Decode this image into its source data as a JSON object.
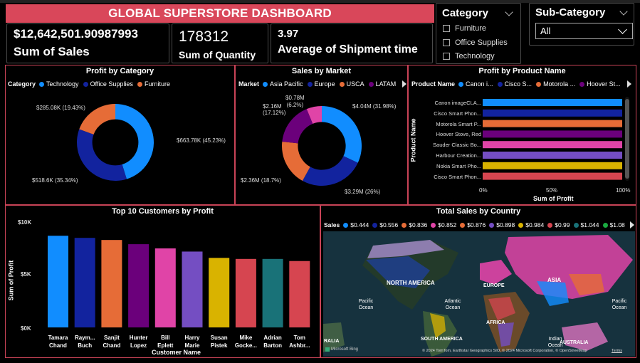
{
  "header": {
    "title": "GLOBAL SUPERSTORE DASHBOARD"
  },
  "kpis": [
    {
      "value": "$12,642,501.90987993",
      "label": "Sum of Sales"
    },
    {
      "value": "178312",
      "label": "Sum of Quantity"
    },
    {
      "value": "3.97",
      "label": "Average of Shipment time"
    }
  ],
  "category_slicer": {
    "title": "Category",
    "options": [
      "Furniture",
      "Office Supplies",
      "Technology"
    ]
  },
  "subcategory_slicer": {
    "title": "Sub-Category",
    "selected": "All"
  },
  "colors": {
    "accent": "#d9475a",
    "border": "#c94357",
    "technology": "#118dff",
    "office_supplies": "#12239e",
    "furniture": "#e66c37",
    "asia_pacific": "#118dff",
    "europe": "#12239e",
    "usca": "#e66c37",
    "latam": "#6b007b",
    "extra": "#e044a7"
  },
  "profit_by_category": {
    "title": "Profit by Category",
    "legend_title": "Category",
    "legend": [
      "Technology",
      "Office Supplies",
      "Furniture"
    ],
    "chart_data": {
      "type": "pie",
      "categories": [
        "Technology",
        "Office Supplies",
        "Furniture"
      ],
      "values": [
        663.78,
        518.6,
        285.08
      ],
      "labels": [
        "$663.78K (45.23%)",
        "$518.6K (35.34%)",
        "$285.08K (19.43%)"
      ]
    }
  },
  "sales_by_market": {
    "title": "Sales by Market",
    "legend_title": "Market",
    "legend": [
      "Asia Pacific",
      "Europe",
      "USCA",
      "LATAM"
    ],
    "chart_data": {
      "type": "pie",
      "categories": [
        "Asia Pacific",
        "Europe",
        "USCA",
        "LATAM",
        "Other"
      ],
      "values": [
        4.04,
        3.29,
        2.36,
        2.16,
        0.78
      ],
      "labels": [
        "$4.04M (31.98%)",
        "$3.29M (26%)",
        "$2.36M (18.7%)",
        "$2.16M (17.12%)",
        "$0.78M (6.2%)"
      ]
    }
  },
  "profit_by_product": {
    "title": "Profit by Product Name",
    "legend_title": "Product Name",
    "legend": [
      "Canon i...",
      "Cisco S...",
      "Motorola ...",
      "Hoover St..."
    ],
    "ylabel": "Product Name",
    "xlabel": "Sum of Profit",
    "x_ticks": [
      "0%",
      "50%",
      "100%"
    ],
    "chart_data": {
      "type": "bar",
      "orientation": "horizontal",
      "categories": [
        "Canon imageCLA...",
        "Cisco Smart Phon...",
        "Motorola Smart P...",
        "Hoover Stove, Red",
        "Sauder Classic Bo...",
        "Harbour Creation...",
        "Nokia Smart Pho...",
        "Cisco Smart Phon..."
      ],
      "values": [
        100,
        100,
        100,
        100,
        100,
        100,
        100,
        100
      ],
      "xlim": [
        0,
        100
      ],
      "colors": [
        "#118dff",
        "#12239e",
        "#e66c37",
        "#6b007b",
        "#e044a7",
        "#744ec2",
        "#d9b300",
        "#d64550"
      ]
    }
  },
  "top_customers": {
    "title": "Top 10 Customers by Profit",
    "ylabel": "Sum of Profit",
    "xlabel": "Customer Name",
    "y_ticks": [
      "$10K",
      "$5K",
      "$0K"
    ],
    "chart_data": {
      "type": "bar",
      "categories": [
        "Tamara Chand",
        "Raymond Buch",
        "Sanjit Chand",
        "Hunter Lopez",
        "Bill Eplett",
        "Harry Marie",
        "Susan Pistek",
        "Mike Gockenbach",
        "Adrian Barton",
        "Tom Ashbrook"
      ],
      "display_names": [
        [
          "Tamara",
          "Chand"
        ],
        [
          "Raym...",
          "Buch"
        ],
        [
          "Sanjit",
          "Chand"
        ],
        [
          "Hunter",
          "Lopez"
        ],
        [
          "Bill",
          "Eplett"
        ],
        [
          "Harry",
          "Marie"
        ],
        [
          "Susan",
          "Pistek"
        ],
        [
          "Mike",
          "Gocke..."
        ],
        [
          "Adrian",
          "Barton"
        ],
        [
          "Tom",
          "Ashbr..."
        ]
      ],
      "values": [
        8.7,
        8.5,
        8.3,
        7.9,
        7.5,
        7.2,
        6.6,
        6.5,
        6.5,
        6.3
      ],
      "ylim": [
        0,
        10
      ],
      "colors": [
        "#118dff",
        "#12239e",
        "#e66c37",
        "#6b007b",
        "#e044a7",
        "#744ec2",
        "#d9b300",
        "#d64550",
        "#197278",
        "#d64550"
      ]
    }
  },
  "sales_by_country": {
    "title": "Total Sales by Country",
    "legend_title": "Sales",
    "legend": [
      "$0.444",
      "$0.556",
      "$0.836",
      "$0.852",
      "$0.876",
      "$0.898",
      "$0.984",
      "$0.99",
      "$1.044",
      "$1.08"
    ],
    "legend_colors": [
      "#118dff",
      "#12239e",
      "#e66c37",
      "#e044a7",
      "#e66c37",
      "#744ec2",
      "#d9b300",
      "#d64550",
      "#197278",
      "#1aab40"
    ],
    "map_labels": [
      "NORTH AMERICA",
      "EUROPE",
      "ASIA",
      "AFRICA",
      "SOUTH AMERICA",
      "AUSTRALIA",
      "Pacific Ocean",
      "Atlantic Ocean",
      "Indian Ocean",
      "Pacific Ocean",
      "RALIA"
    ],
    "attribution": "© 2024 TomTom, Earthstar Geographics SIO, © 2024 Microsoft Corporation, © OpenStreetMap",
    "terms": "Terms",
    "brand": "Microsoft Bing"
  }
}
